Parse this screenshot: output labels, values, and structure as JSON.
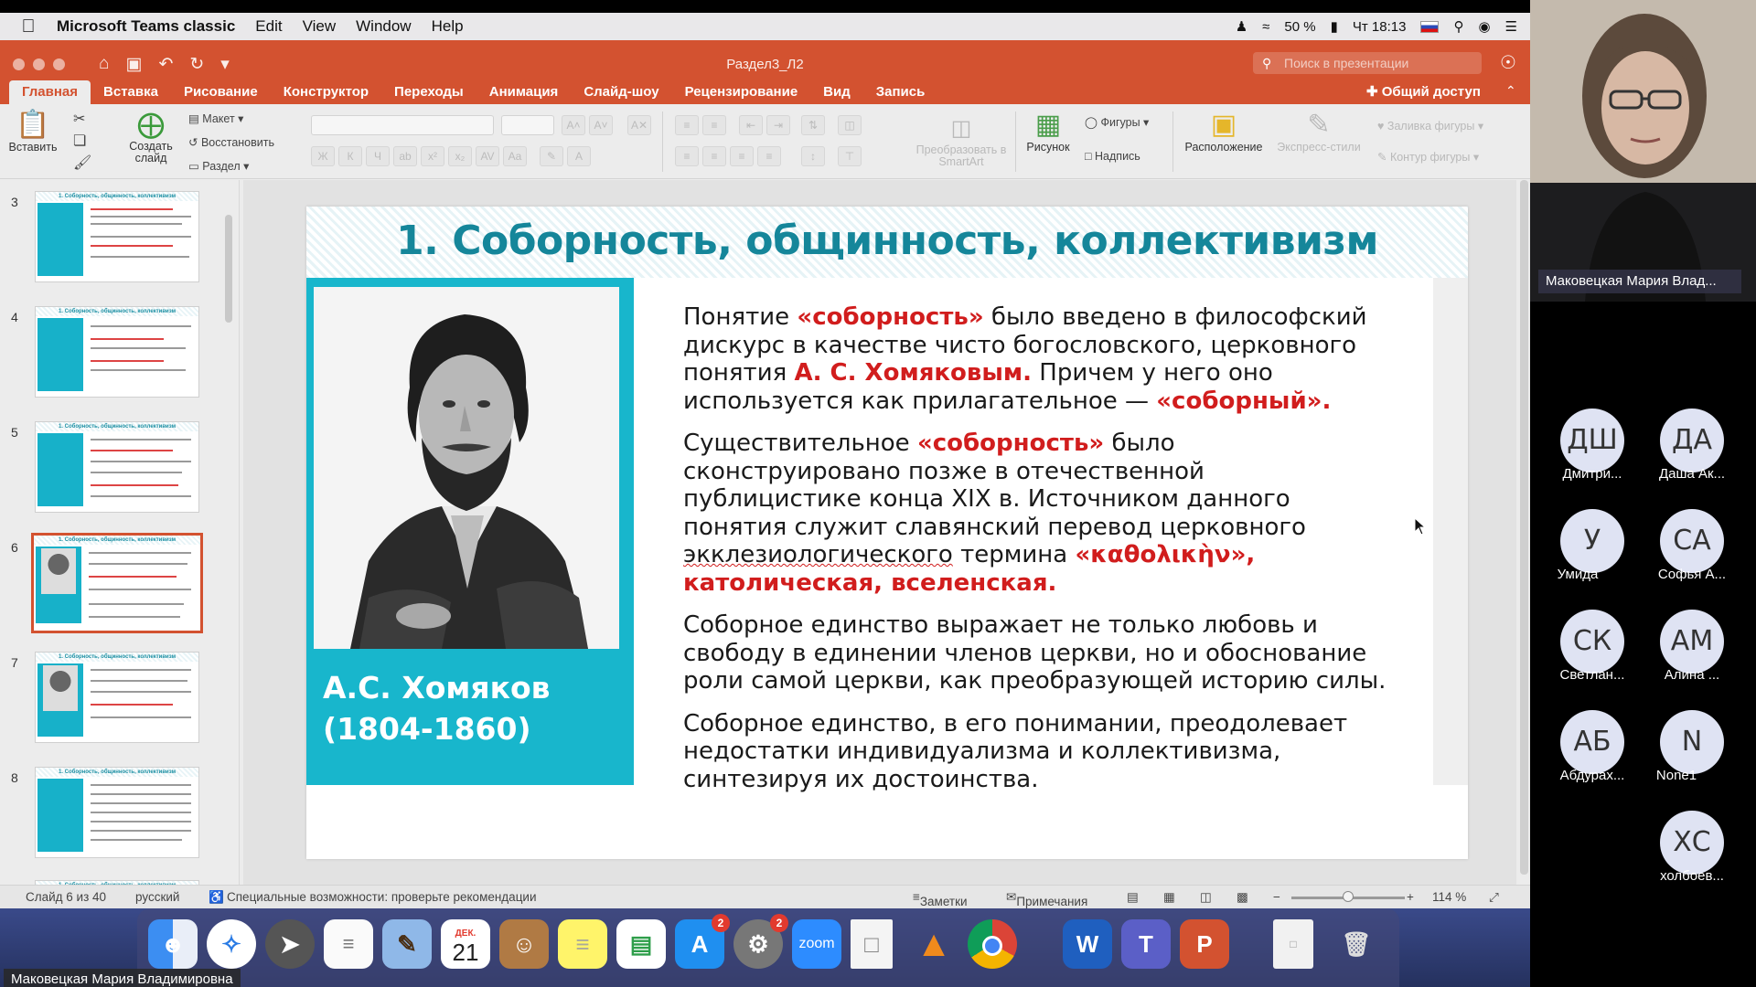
{
  "menubar": {
    "app_name": "Microsoft Teams classic",
    "items": [
      "Edit",
      "View",
      "Window",
      "Help"
    ],
    "battery": "50 %",
    "clock": "Чт 18:13"
  },
  "ppt": {
    "doc_title": "Раздел3_Л2",
    "search_placeholder": "Поиск в презентации",
    "share_label": "Общий доступ",
    "tabs": [
      "Главная",
      "Вставка",
      "Рисование",
      "Конструктор",
      "Переходы",
      "Анимация",
      "Слайд-шоу",
      "Рецензирование",
      "Вид",
      "Запись"
    ],
    "active_tab": "Главная"
  },
  "ribbon": {
    "paste": "Вставить",
    "new_slide": "Создать слайд",
    "layout": "Макет",
    "reset": "Восстановить",
    "section": "Раздел",
    "smartart": "Преобразовать в SmartArt",
    "picture": "Рисунок",
    "shapes": "Фигуры",
    "textbox": "Надпись",
    "arrange": "Расположение",
    "quick_styles": "Экспресс-стили",
    "shape_fill": "Заливка фигуры",
    "shape_outline": "Контур фигуры"
  },
  "thumbnails": {
    "numbers": [
      "3",
      "4",
      "5",
      "6",
      "7",
      "8"
    ],
    "selected": "6",
    "thumb_title": "1. Соборность, общинность, коллективизм"
  },
  "slide": {
    "title": "1. Соборность, общинность, коллективизм",
    "caption_name": "А.С. Хомяков",
    "caption_years": "(1804-1860)",
    "p1_a": "Понятие ",
    "p1_b": "«соборность»",
    "p1_c": " было введено в философский дискурс в качестве чисто богословского, церковного понятия ",
    "p1_d": "А. С. Хомяковым.",
    "p1_e": " Причем у него оно используется как прилагательное — ",
    "p1_f": "«соборный».",
    "p2_a": "Существительное ",
    "p2_b": "«соборность»",
    "p2_c": " было сконструировано позже в отечественной публицистике конца XIX в. Источником данного понятия служит славянский перевод церковного ",
    "p2_d": "экклезиологического",
    "p2_e": " термина ",
    "p2_f": "«καθολικὴν», католическая, вселенская.",
    "p3": " Соборное единство выражает не только любовь и свободу в единении членов церкви, но и обоснование роли самой церкви, как преобразующей историю силы.",
    "p4": "Соборное единство, в его понимании, преодолевает недостатки индивидуализма и коллективизма, синтезируя их достоинства."
  },
  "status": {
    "slide_info": "Слайд 6 из 40",
    "language": "русский",
    "accessibility": "Специальные возможности: проверьте рекомендации",
    "notes": "Заметки",
    "comments": "Примечания",
    "zoom": "114 %"
  },
  "dock": {
    "calendar_month": "ДЕК.",
    "calendar_day": "21",
    "badge_appstore": "2",
    "badge_settings": "2",
    "zoom_label": "zoom"
  },
  "presenter": "Маковецкая Мария Владимировна",
  "webcam_name": "Маковецкая Мария Влад...",
  "participants": [
    {
      "initials": "ДШ",
      "name": "Дмитри..."
    },
    {
      "initials": "ДА",
      "name": "Даша Ак..."
    },
    {
      "initials": "У",
      "name": "Умида"
    },
    {
      "initials": "СА",
      "name": "Софья А..."
    },
    {
      "initials": "СК",
      "name": "Светлан..."
    },
    {
      "initials": "АМ",
      "name": "Алина ..."
    },
    {
      "initials": "АБ",
      "name": "Абдурах..."
    },
    {
      "initials": "N",
      "name": "None1"
    },
    {
      "initials": "ХС",
      "name": "холбоев..."
    }
  ]
}
